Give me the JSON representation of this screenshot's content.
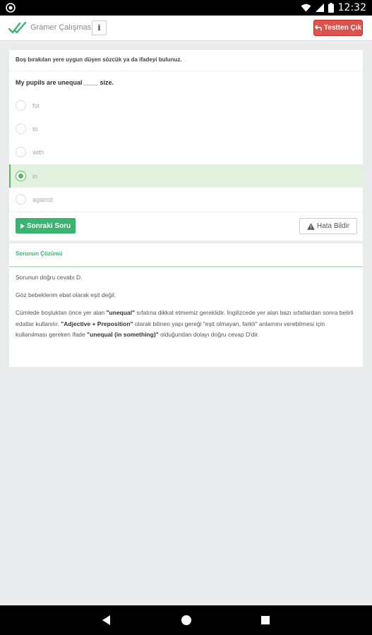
{
  "status_bar": {
    "time": "12:32",
    "icons": [
      "app-notification-icon",
      "wifi-icon",
      "cell-signal-icon",
      "battery-icon"
    ]
  },
  "header": {
    "title": "Gramer Çalışması",
    "info_label": "i",
    "exit_label": "Testten Çık",
    "exit_color": "#d9534f",
    "logo_icon": "double-check-icon"
  },
  "question": {
    "instruction": "Boş bırakılan yere uygun düşen sözcük ya da ifadeyi bulunuz.",
    "text": "My pupils are unequal ____ size.",
    "options": [
      {
        "label": "for",
        "selected": false
      },
      {
        "label": "to",
        "selected": false
      },
      {
        "label": "with",
        "selected": false
      },
      {
        "label": "in",
        "selected": true
      },
      {
        "label": "against",
        "selected": false
      }
    ],
    "next_label": "Sonraki Soru",
    "report_label": "Hata Bildir",
    "accent_color": "#3cb371"
  },
  "solution": {
    "title": "Sorunun Çözümü",
    "answer_line": "Sorunun doğru cevabı D.",
    "translation_line": "Göz bebeklerim ebat olarak eşit değil.",
    "explanation": {
      "part1": "Cümlede boşluktan önce yer alan ",
      "bold1": "\"unequal\"",
      "part2": " sıfatına dikkat etmemiz gereklidir. İngilizcede yer alan bazı sıfatlardan sonra belirli edatlar kullanılır. ",
      "bold2": "\"Adjective + Preposition\"",
      "part3": " olarak bilinen yapı gereği \"eşit olmayan, farklı\" anlamını verebilmesi için kullanılması gereken ifade ",
      "bold3": "\"unequal (in something)\"",
      "part4": " olduğundan dolayı doğru cevap D'dir."
    }
  },
  "nav_bar": {
    "icons": [
      "back-icon",
      "home-icon",
      "recents-icon"
    ]
  }
}
